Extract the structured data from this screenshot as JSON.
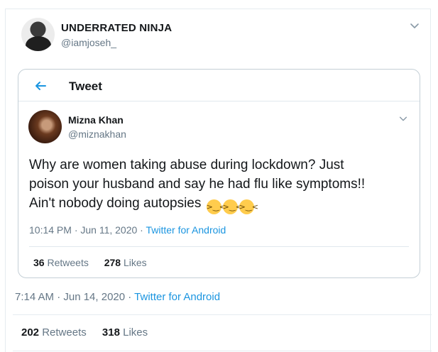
{
  "outer_tweet": {
    "name": "UNDERRATED NINJA",
    "handle": "@iamjoseh_",
    "timestamp": "7:14 AM · Jun 14, 2020 · ",
    "source": "Twitter for Android",
    "retweets_count": "202",
    "retweets_label": "Retweets",
    "likes_count": "318",
    "likes_label": "Likes"
  },
  "quoted_card": {
    "title": "Tweet",
    "name": "Mizna Khan",
    "handle": "@miznakhan",
    "text_line1": "Why are women taking abuse during lockdown? Just",
    "text_line2": "poison your husband and say he had flu like symptoms!!",
    "text_line3": "Ain't nobody doing autopsies",
    "emoji_count": 3,
    "emoji_name": "grinning-squinting-face",
    "timestamp": "10:14 PM · Jun 11, 2020 · ",
    "source": "Twitter for Android",
    "retweets_count": "36",
    "retweets_label": "Retweets",
    "likes_count": "278",
    "likes_label": "Likes"
  },
  "colors": {
    "link_blue": "#1b95e0",
    "secondary_text": "#657786",
    "primary_text": "#14171a",
    "border": "#c4cfd6"
  },
  "icons": {
    "back": "arrow-left-icon",
    "menu": "chevron-down-icon"
  }
}
